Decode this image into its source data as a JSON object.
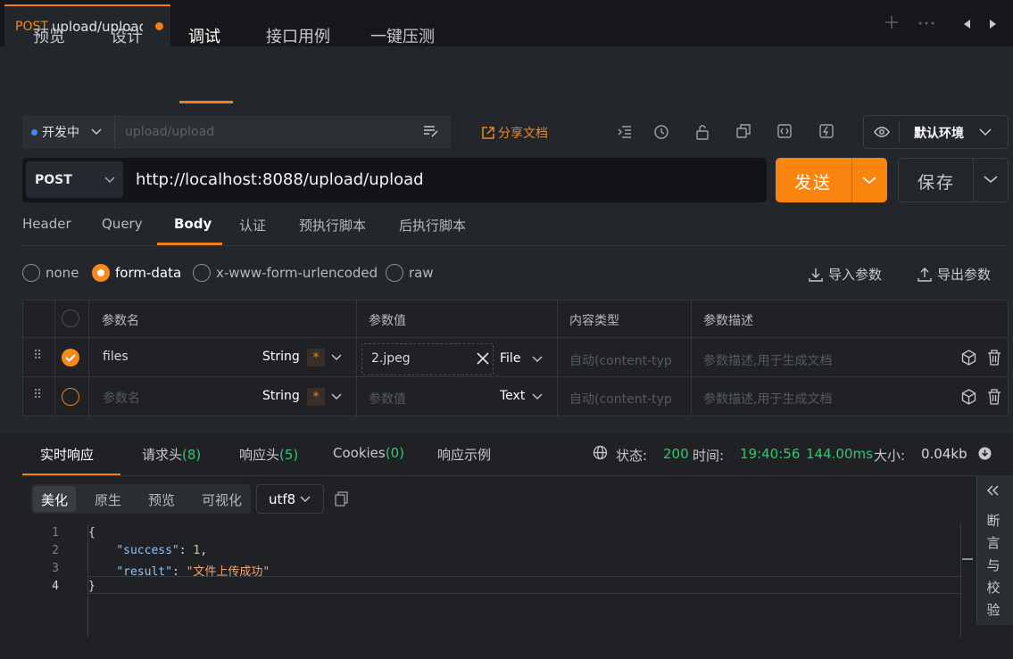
{
  "tab": {
    "method": "POST",
    "title": "upload/upload"
  },
  "subnav": [
    "预览",
    "设计",
    "调试",
    "接口用例",
    "一键压测"
  ],
  "toolbar": {
    "status": "开发中",
    "path_placeholder": "upload/upload",
    "share": "分享文档",
    "env": "默认环境"
  },
  "request": {
    "method": "POST",
    "url": "http://localhost:8088/upload/upload",
    "send": "发送",
    "save": "保存"
  },
  "req_tabs": [
    "Header",
    "Query",
    "Body",
    "认证",
    "预执行脚本",
    "后执行脚本"
  ],
  "body_types": [
    "none",
    "form-data",
    "x-www-form-urlencoded",
    "raw"
  ],
  "io": {
    "import": "导入参数",
    "export": "导出参数"
  },
  "table": {
    "headers": [
      "参数名",
      "参数值",
      "内容类型",
      "参数描述"
    ],
    "rows": [
      {
        "name": "files",
        "type": "String",
        "required": "*",
        "value": "2.jpeg",
        "value_kind": "File",
        "content_type_placeholder": "自动(content-typ",
        "desc_placeholder": "参数描述,用于生成文档"
      },
      {
        "name_placeholder": "参数名",
        "type": "String",
        "required": "*",
        "value_placeholder": "参数值",
        "value_kind": "Text",
        "content_type_placeholder": "自动(content-typ",
        "desc_placeholder": "参数描述,用于生成文档"
      }
    ]
  },
  "response": {
    "tabs": [
      "实时响应",
      "请求头",
      "响应头",
      "Cookies",
      "响应示例"
    ],
    "tab_counts": [
      "(8)",
      "(5)",
      "(0)"
    ],
    "status_label": "状态:",
    "status": "200",
    "time_label": "时间:",
    "time": "19:40:56",
    "duration": "144.00ms",
    "size_label": "大小:",
    "size": "0.04kb",
    "formats": [
      "美化",
      "原生",
      "预览",
      "可视化"
    ],
    "encoding": "utf8",
    "code": {
      "line_numbers": [
        "1",
        "2",
        "3",
        "4"
      ],
      "open": "{",
      "key1": "\"success\"",
      "val1": "1",
      "key2": "\"result\"",
      "val2": "\"文件上传成功\"",
      "close": "}"
    },
    "side_panel": [
      "断",
      "言",
      "与",
      "校",
      "验"
    ]
  }
}
